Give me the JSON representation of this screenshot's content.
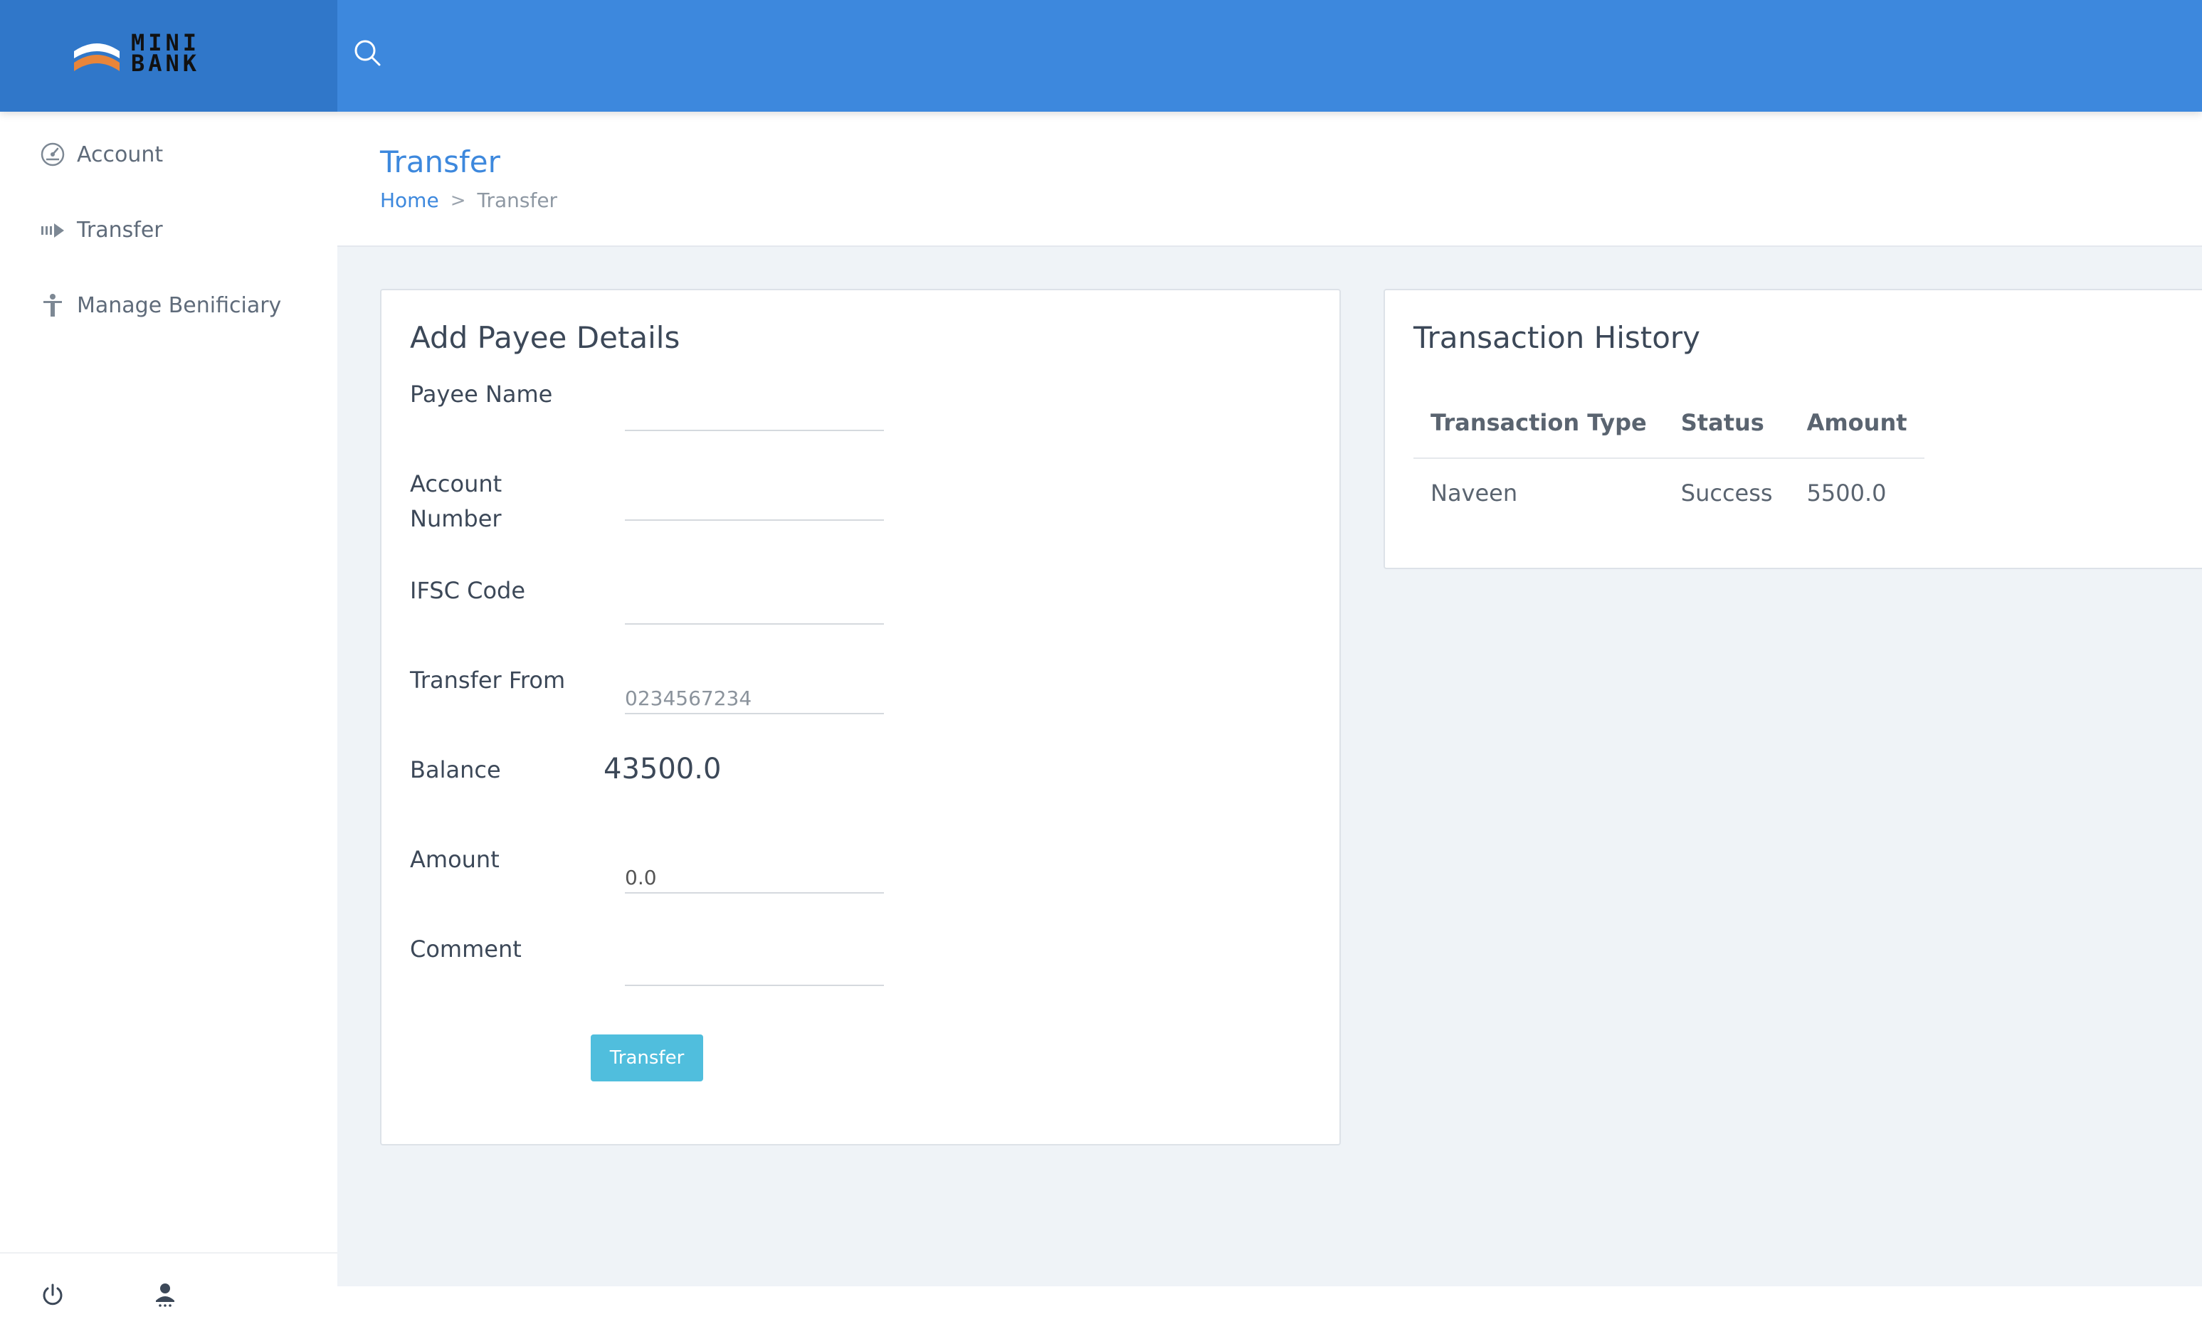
{
  "brand": {
    "line1": "MINI",
    "line2": "BANK"
  },
  "icons": {
    "search": "search-icon",
    "power": "power-icon",
    "user": "user-icon"
  },
  "sidebar": {
    "items": [
      {
        "label": "Account",
        "icon": "dashboard-icon"
      },
      {
        "label": "Transfer",
        "icon": "transfer-icon"
      },
      {
        "label": "Manage Benificiary",
        "icon": "person-icon"
      }
    ]
  },
  "page": {
    "title": "Transfer",
    "breadcrumb": {
      "home": "Home",
      "separator": ">",
      "current": "Transfer"
    }
  },
  "payee_form": {
    "title": "Add Payee Details",
    "fields": {
      "payee_name": {
        "label": "Payee Name",
        "value": ""
      },
      "account_number": {
        "label": "Account Number",
        "value": ""
      },
      "ifsc_code": {
        "label": "IFSC Code",
        "value": ""
      },
      "transfer_from": {
        "label": "Transfer From",
        "value": "0234567234"
      },
      "balance": {
        "label": "Balance",
        "value": "43500.0"
      },
      "amount": {
        "label": "Amount",
        "value": "0.0"
      },
      "comment": {
        "label": "Comment",
        "value": ""
      }
    },
    "submit_label": "Transfer"
  },
  "history": {
    "title": "Transaction History",
    "columns": [
      "Transaction Type",
      "Status",
      "Amount"
    ],
    "rows": [
      {
        "type": "Naveen",
        "status": "Success",
        "amount": "5500.0"
      }
    ]
  },
  "colors": {
    "topbar": "#3d88dd",
    "logo_bg": "#3077c9",
    "accent": "#3d88dd",
    "button": "#50bedd",
    "page_bg": "#eff3f7"
  }
}
